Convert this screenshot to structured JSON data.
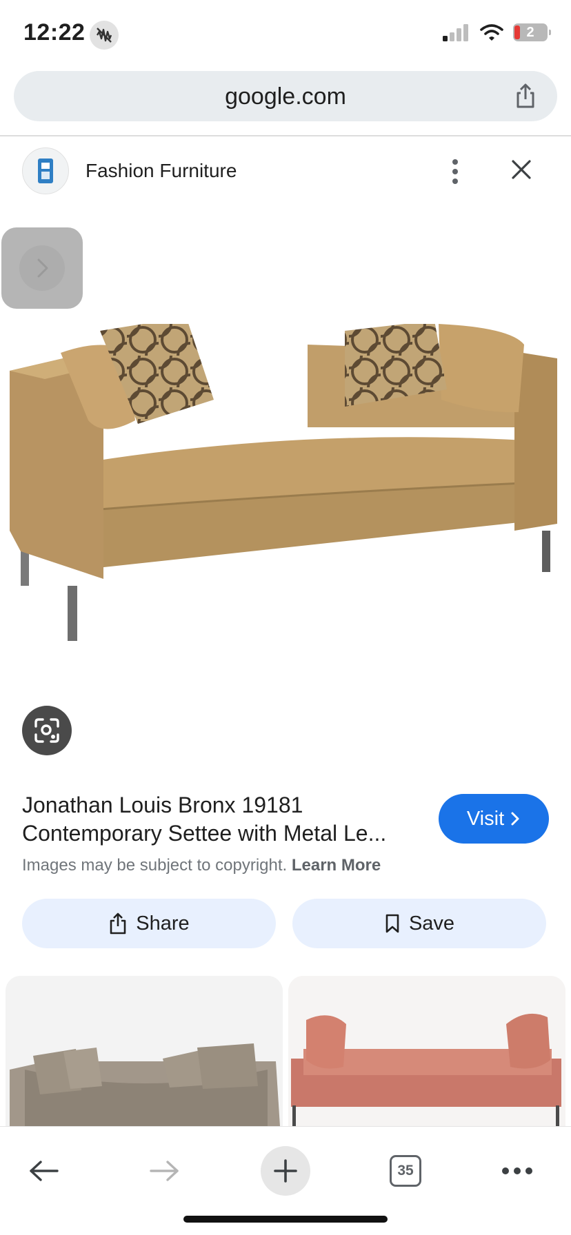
{
  "status_bar": {
    "time": "12:22",
    "battery_level": "2"
  },
  "address_bar": {
    "url": "google.com"
  },
  "source": {
    "name": "Fashion Furniture"
  },
  "result": {
    "title_line1": "Jonathan Louis Bronx 19181",
    "title_line2": "Contemporary Settee with Metal Le...",
    "visit_label": "Visit",
    "copyright_text": "Images may be subject to copyright.",
    "learn_more_label": "Learn More"
  },
  "actions": {
    "share_label": "Share",
    "save_label": "Save"
  },
  "toolbar": {
    "tab_count": "35"
  },
  "icons": {
    "dnd": "do-not-disturb-icon",
    "signal": "signal-icon",
    "wifi": "wifi-icon",
    "battery": "battery-icon",
    "share": "share-icon",
    "more": "more-vertical-icon",
    "close": "close-icon",
    "next": "chevron-right-icon",
    "lens": "lens-icon",
    "bookmark": "bookmark-icon",
    "back": "arrow-left-icon",
    "forward": "arrow-right-icon",
    "new_tab": "plus-icon",
    "menu": "more-horizontal-icon"
  },
  "colors": {
    "accent": "#1a73e8",
    "action_button_bg": "#e8f0fe",
    "address_bar_bg": "#e8ecef"
  }
}
